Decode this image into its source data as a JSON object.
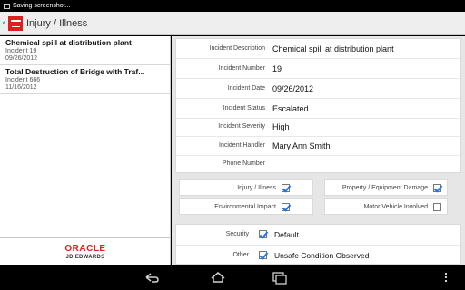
{
  "status_bar": {
    "text": "Saving screenshot..."
  },
  "action_bar": {
    "back_glyph": "‹",
    "title": "Injury / Illness"
  },
  "incident_list": [
    {
      "title": "Chemical spill at distribution plant",
      "incident": "Incident 19",
      "date": "09/26/2012"
    },
    {
      "title": "Total Destruction of Bridge with Traf...",
      "incident": "Incident 666",
      "date": "11/16/2012"
    }
  ],
  "branding": {
    "oracle": "ORACLE",
    "jde": "JD EDWARDS"
  },
  "details": [
    {
      "label": "Incident Description",
      "value": "Chemical spill at distribution plant"
    },
    {
      "label": "Incident Number",
      "value": "19"
    },
    {
      "label": "Incident Date",
      "value": "09/26/2012"
    },
    {
      "label": "Incident Status",
      "value": "Escalated"
    },
    {
      "label": "Incident Severity",
      "value": "High"
    },
    {
      "label": "Incident Handler",
      "value": "Mary Ann Smith"
    },
    {
      "label": "Phone Number",
      "value": ""
    }
  ],
  "categories": [
    {
      "label": "Injury / Illness",
      "checked": true
    },
    {
      "label": "Property / Equipment Damage",
      "checked": true
    },
    {
      "label": "Environmental Impact",
      "checked": true
    },
    {
      "label": "Motor Vehicle Involved",
      "checked": false
    }
  ],
  "classification": [
    {
      "label": "Security",
      "checked": true,
      "value": "Default"
    },
    {
      "label": "Other",
      "checked": true,
      "value": "Unsafe Condition Observed"
    }
  ],
  "colors": {
    "accent": "#1f77e0",
    "oracle_red": "#e0211d",
    "panel_bg": "#e6e6e6"
  },
  "nav_icons": [
    "back-icon",
    "home-icon",
    "recent-apps-icon",
    "menu-icon"
  ]
}
